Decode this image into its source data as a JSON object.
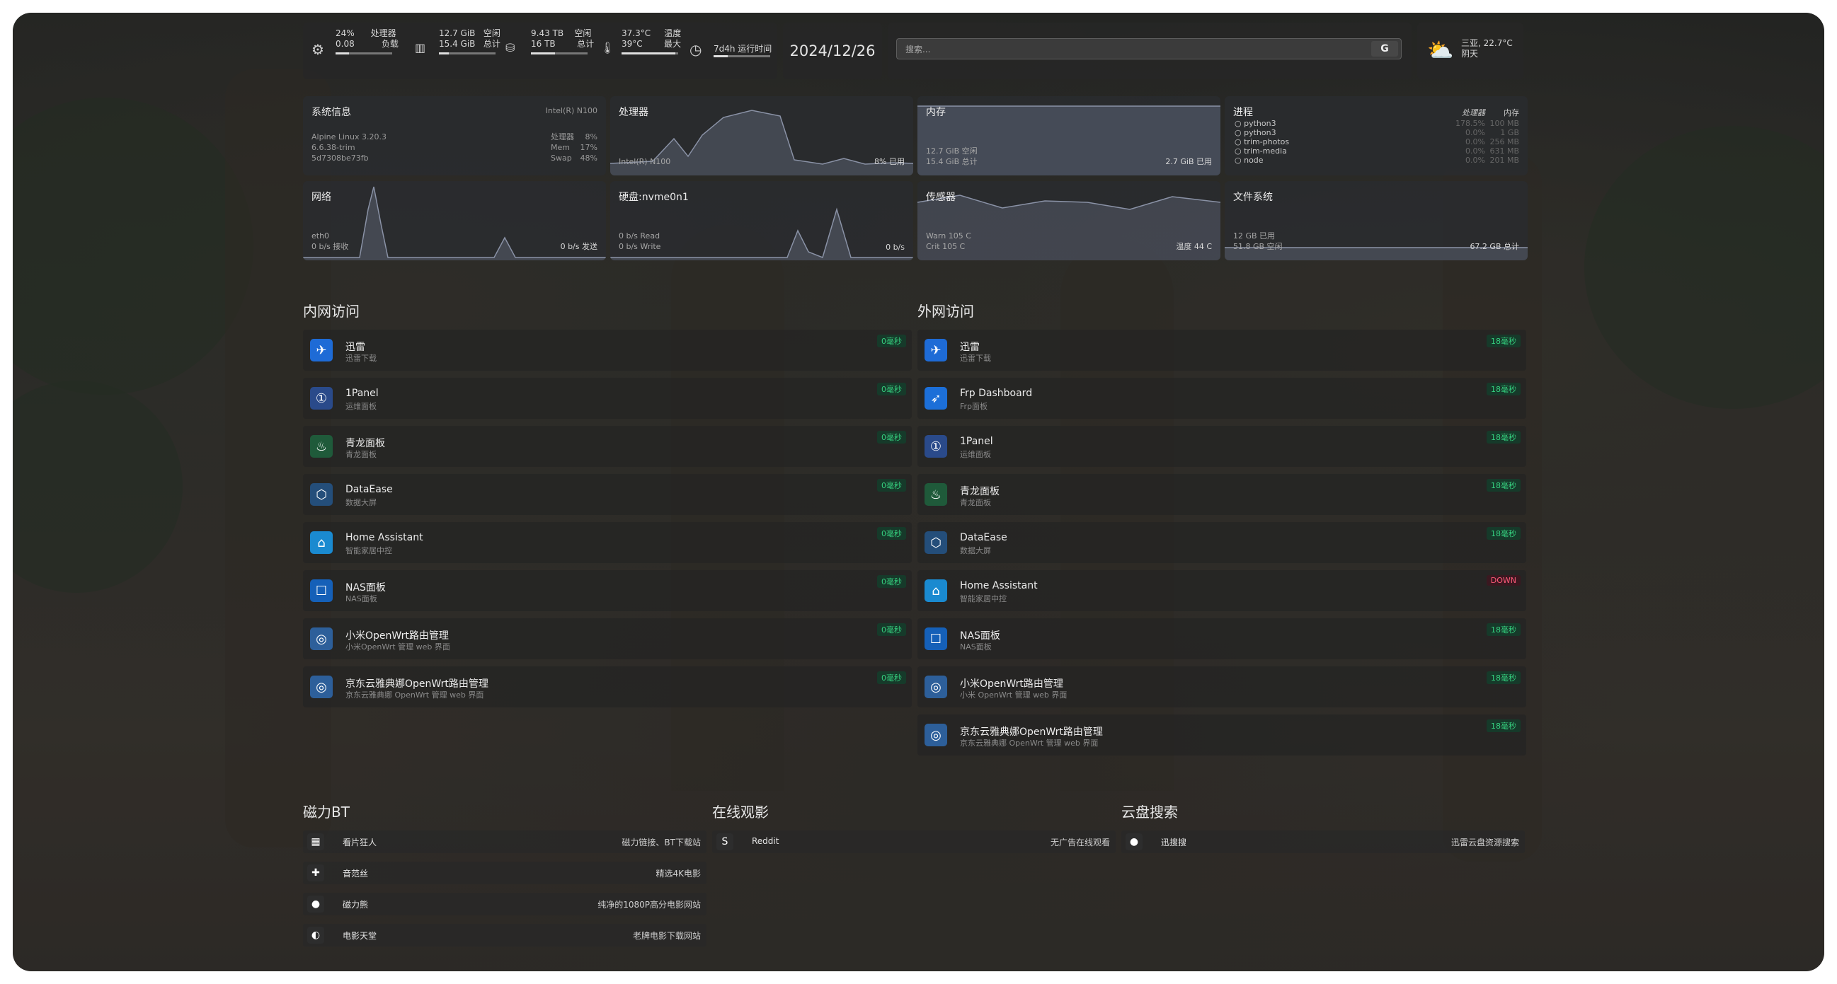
{
  "top_stats": {
    "cpu": {
      "v1": "24%",
      "v2": "0.08",
      "l1": "处理器",
      "l2": "负载",
      "fill": 0.24
    },
    "mem": {
      "v1": "12.7 GiB",
      "v2": "15.4 GiB",
      "l1": "空闲",
      "l2": "总计",
      "fill": 0.18
    },
    "disk": {
      "v1": "9.43 TB",
      "v2": "16 TB",
      "l1": "空闲",
      "l2": "总计",
      "fill": 0.42
    },
    "temp": {
      "v1": "37.3°C",
      "v2": "39°C",
      "l1": "温度",
      "l2": "最大",
      "fill": 0.95
    },
    "uptime": {
      "v1": "7d4h 运行时间",
      "fill": 0.25
    }
  },
  "date": "2024/12/26",
  "search": {
    "placeholder": "搜索...",
    "engine": "G"
  },
  "weather": {
    "line1": "三亚, 22.7°C",
    "line2": "阴天"
  },
  "widgets": {
    "sysinfo": {
      "title": "系统信息",
      "cpu_model": "Intel(R) N100",
      "os": "Alpine Linux 3.20.3",
      "kernel": "6.6.38-trim",
      "host": "5d7308be73fb",
      "labels": [
        "处理器",
        "Mem",
        "Swap"
      ],
      "values": [
        "8%",
        "17%",
        "48%"
      ]
    },
    "cpu": {
      "title": "处理器",
      "bl": "Intel(R) N100",
      "br": "8% 已用"
    },
    "memory": {
      "title": "内存",
      "bl1": "12.7 GiB 空闲",
      "bl2": "15.4 GiB 总计",
      "br": "2.7 GiB 已用"
    },
    "process": {
      "title": "进程",
      "h1": "处理器",
      "h2": "内存",
      "names": [
        "python3",
        "python3",
        "trim-photos",
        "trim-media",
        "node"
      ],
      "cpu": [
        "178.5%",
        "0.0%",
        "0.0%",
        "0.0%",
        "0.0%"
      ],
      "mem": [
        "100 MB",
        "1 GB",
        "256 MB",
        "631 MB",
        "201 MB"
      ]
    },
    "network": {
      "title": "网络",
      "bl1": "eth0",
      "bl2": "0 b/s 接收",
      "br": "0 b/s 发送"
    },
    "disk": {
      "title": "硬盘:nvme0n1",
      "bl1": "0 b/s Read",
      "bl2": "0 b/s Write",
      "br": "0 b/s"
    },
    "sensors": {
      "title": "传感器",
      "bl1": "Warn 105 C",
      "bl2": "Crit 105 C",
      "br": "温度 44 C"
    },
    "fs": {
      "title": "文件系统",
      "bl1": "12 GB 已用",
      "bl2": "51.8 GB 空闲",
      "br": "67.2 GB 总计"
    }
  },
  "lan": {
    "title": "内网访问",
    "items": [
      {
        "name": "迅雷",
        "sub": "迅雷下载",
        "badge": "0毫秒",
        "icon": "bird-icon",
        "color": "#1e6bd6"
      },
      {
        "name": "1Panel",
        "sub": "运维面板",
        "badge": "0毫秒",
        "icon": "1panel-icon",
        "color": "#2a4a8a"
      },
      {
        "name": "青龙面板",
        "sub": "青龙面板",
        "badge": "0毫秒",
        "icon": "dragon-icon",
        "color": "#1f5a3a"
      },
      {
        "name": "DataEase",
        "sub": "数据大屏",
        "badge": "0毫秒",
        "icon": "dataease-icon",
        "color": "#244e7a"
      },
      {
        "name": "Home Assistant",
        "sub": "智能家居中控",
        "badge": "0毫秒",
        "icon": "home-icon",
        "color": "#1a8ad0"
      },
      {
        "name": "NAS面板",
        "sub": "NAS面板",
        "badge": "0毫秒",
        "icon": "nas-icon",
        "color": "#1560b8"
      },
      {
        "name": "小米OpenWrt路由管理",
        "sub": "小米OpenWrt 管理 web 界面",
        "badge": "0毫秒",
        "icon": "openwrt-icon",
        "color": "#2d5f9a"
      },
      {
        "name": "京东云雅典娜OpenWrt路由管理",
        "sub": "京东云雅典娜 OpenWrt 管理 web 界面",
        "badge": "0毫秒",
        "icon": "openwrt-icon",
        "color": "#2d5f9a"
      }
    ]
  },
  "wan": {
    "title": "外网访问",
    "items": [
      {
        "name": "迅雷",
        "sub": "迅雷下载",
        "badge": "18毫秒",
        "icon": "bird-icon",
        "color": "#1e6bd6"
      },
      {
        "name": "Frp Dashboard",
        "sub": "Frp面板",
        "badge": "18毫秒",
        "icon": "frp-icon",
        "color": "#1c6fd8"
      },
      {
        "name": "1Panel",
        "sub": "运维面板",
        "badge": "18毫秒",
        "icon": "1panel-icon",
        "color": "#2a4a8a"
      },
      {
        "name": "青龙面板",
        "sub": "青龙面板",
        "badge": "18毫秒",
        "icon": "dragon-icon",
        "color": "#1f5a3a"
      },
      {
        "name": "DataEase",
        "sub": "数据大屏",
        "badge": "18毫秒",
        "icon": "dataease-icon",
        "color": "#244e7a"
      },
      {
        "name": "Home Assistant",
        "sub": "智能家居中控",
        "badge": "DOWN",
        "icon": "home-icon",
        "color": "#1a8ad0"
      },
      {
        "name": "NAS面板",
        "sub": "NAS面板",
        "badge": "18毫秒",
        "icon": "nas-icon",
        "color": "#1560b8"
      },
      {
        "name": "小米OpenWrt路由管理",
        "sub": "小米 OpenWrt 管理 web 界面",
        "badge": "18毫秒",
        "icon": "openwrt-icon",
        "color": "#2d5f9a"
      },
      {
        "name": "京东云雅典娜OpenWrt路由管理",
        "sub": "京东云雅典娜 OpenWrt 管理 web 界面",
        "badge": "18毫秒",
        "icon": "openwrt-icon",
        "color": "#2d5f9a"
      }
    ]
  },
  "bt": {
    "title": "磁力BT",
    "items": [
      {
        "name": "看片狂人",
        "desc": "磁力链接、BT下载站",
        "glyph": "▦"
      },
      {
        "name": "音范丝",
        "desc": "精选4K电影",
        "glyph": "✚"
      },
      {
        "name": "磁力熊",
        "desc": "纯净的1080P高分电影网站",
        "glyph": "●"
      },
      {
        "name": "电影天堂",
        "desc": "老牌电影下载网站",
        "glyph": "◐"
      }
    ]
  },
  "movie": {
    "title": "在线观影",
    "items": [
      {
        "name": "Reddit",
        "desc": "无广告在线观看",
        "glyph": "S"
      }
    ]
  },
  "cloud": {
    "title": "云盘搜索",
    "items": [
      {
        "name": "迅搜搜",
        "desc": "迅雷云盘资源搜索",
        "glyph": "●"
      }
    ]
  }
}
